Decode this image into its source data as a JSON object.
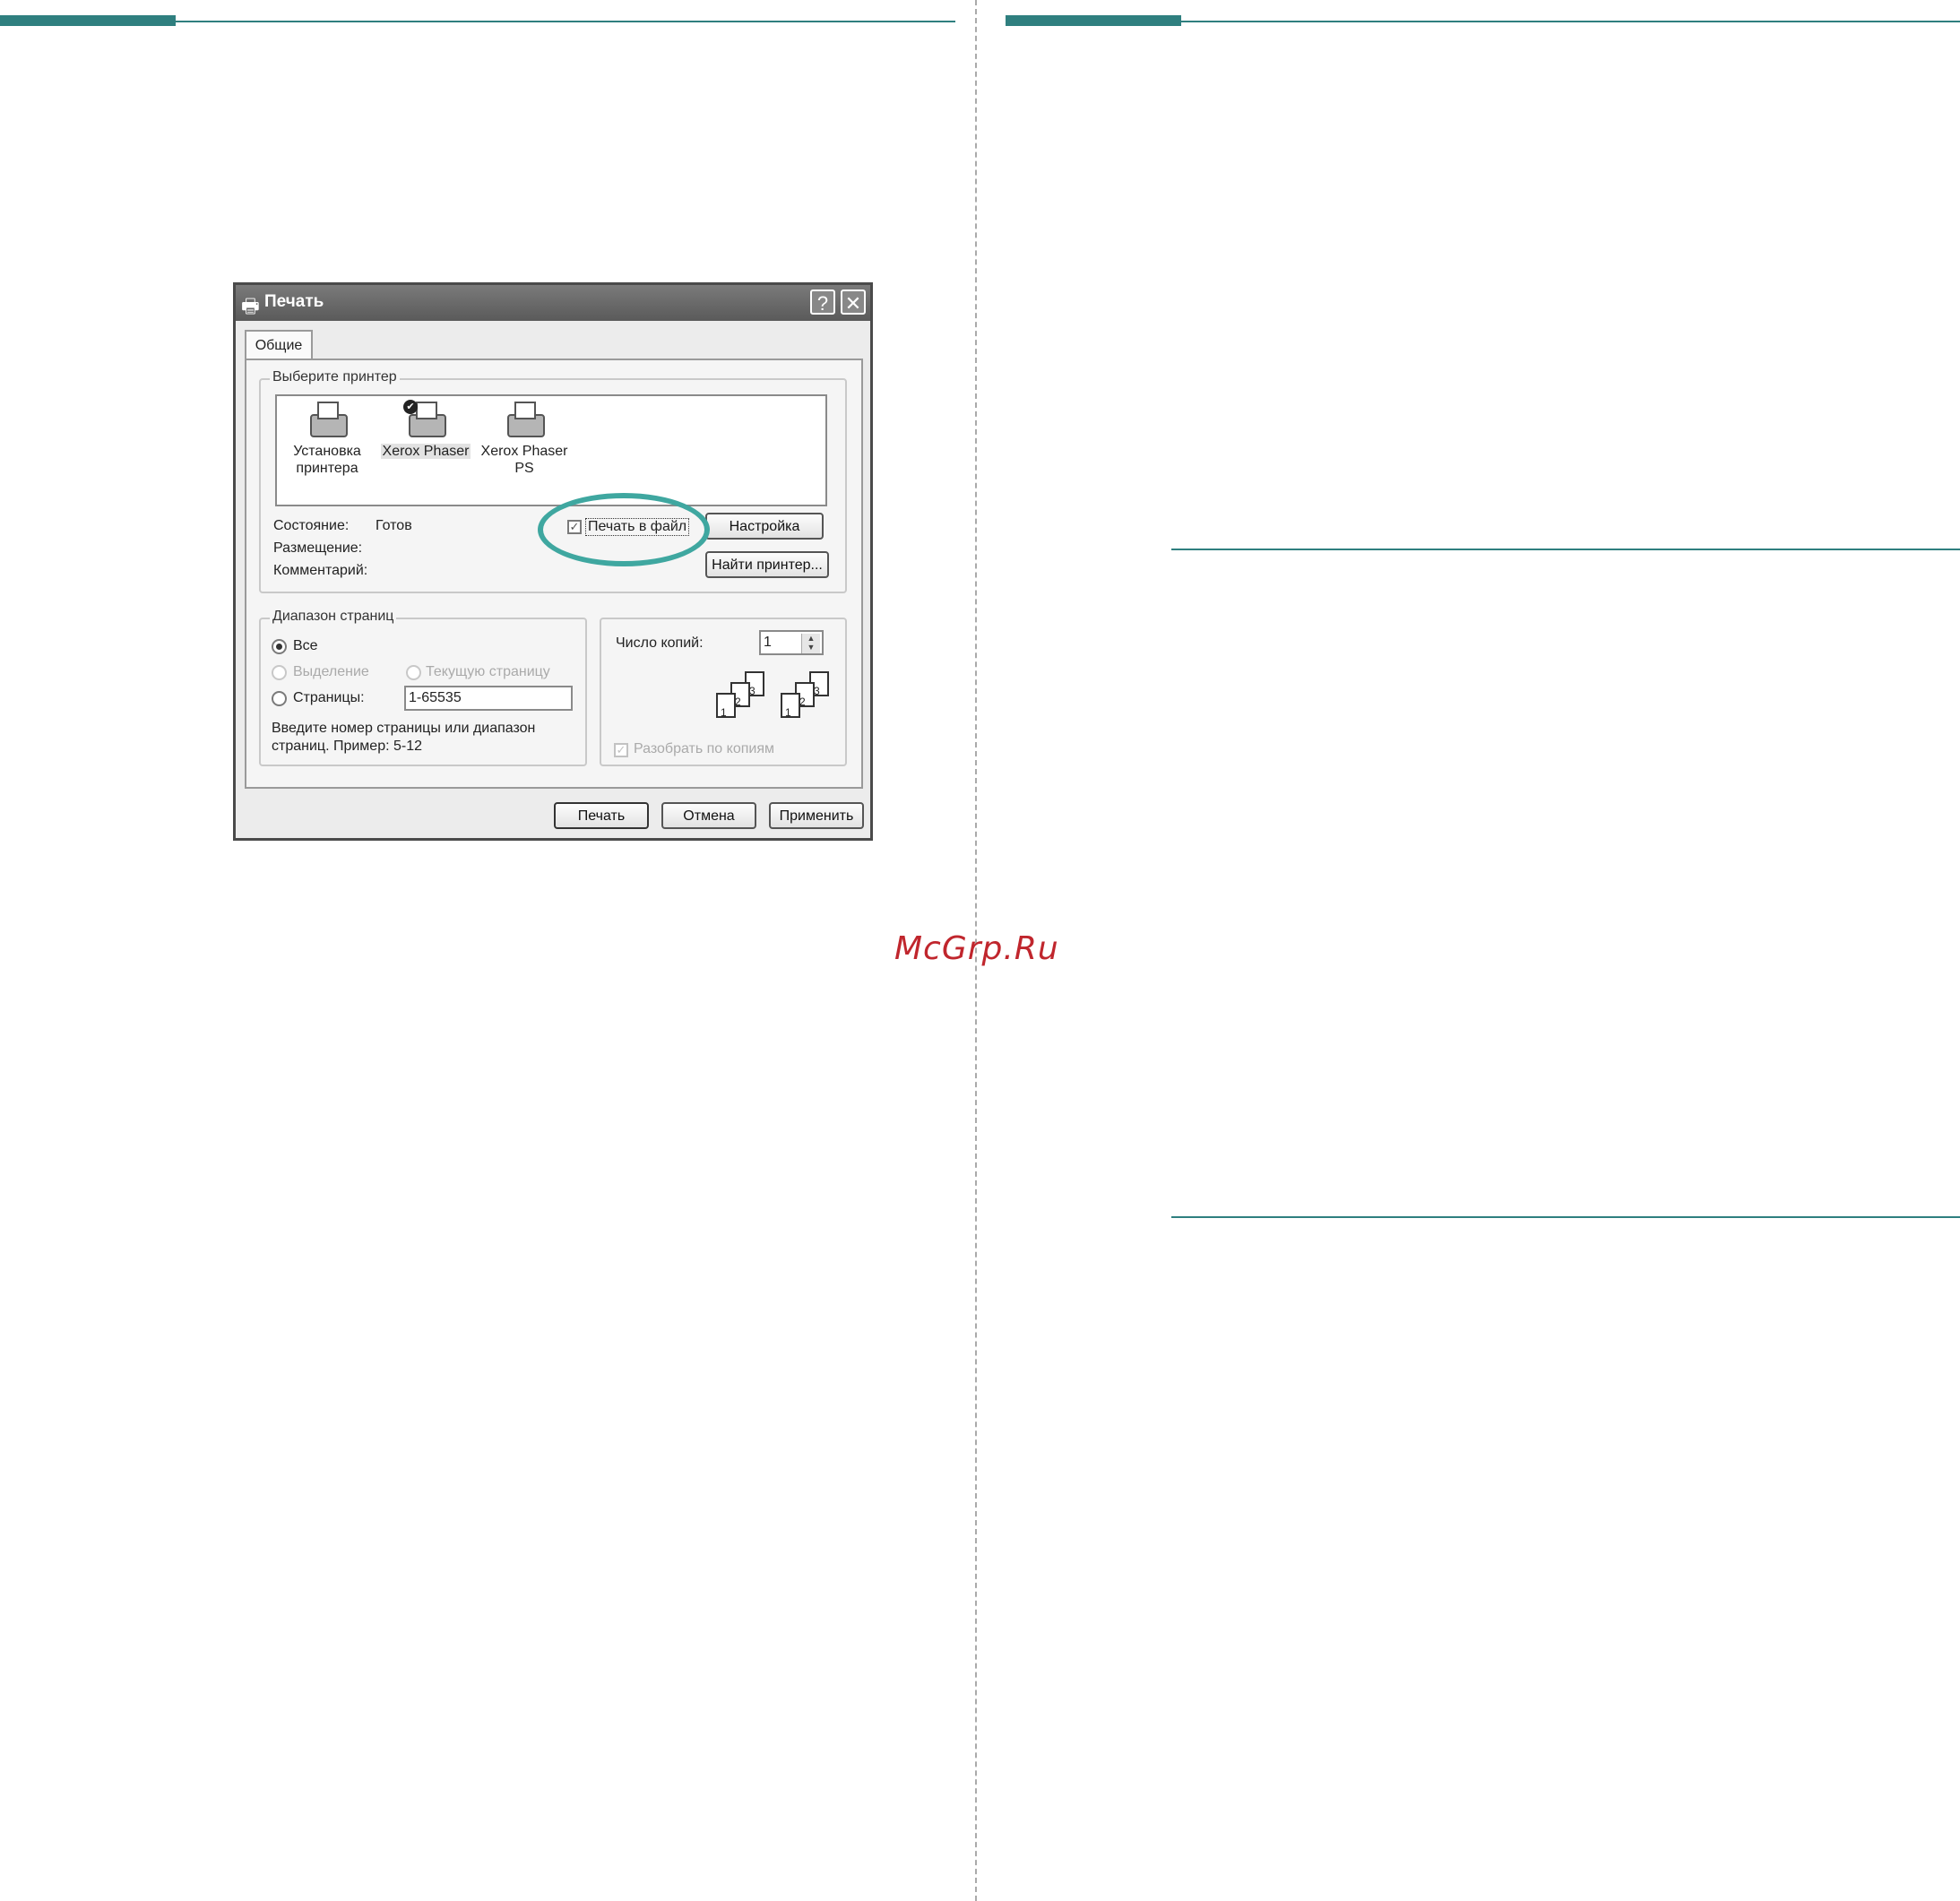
{
  "watermark": "McGrp.Ru",
  "dialog": {
    "title": "Печать",
    "help_btn": "?",
    "close_btn": "✕",
    "tab": "Общие",
    "printer_group": {
      "label": "Выберите принтер",
      "printers": [
        {
          "name_line1": "Установка",
          "name_line2": "принтера",
          "icon": "add-printer-icon"
        },
        {
          "name_line1": "Xerox Phaser",
          "name_line2": "",
          "icon": "printer-icon",
          "selected": true,
          "default": true
        },
        {
          "name_line1": "Xerox Phaser",
          "name_line2": "PS",
          "icon": "printer-icon"
        }
      ],
      "status_label": "Состояние:",
      "status_value": "Готов",
      "location_label": "Размещение:",
      "comment_label": "Комментарий:",
      "print_to_file": "Печать в файл",
      "print_to_file_checked": true,
      "settings_button": "Настройка",
      "find_button": "Найти принтер..."
    },
    "range_group": {
      "label": "Диапазон страниц",
      "all": "Все",
      "selection": "Выделение",
      "current_page": "Текущую страницу",
      "pages": "Страницы:",
      "pages_value": "1-65535",
      "hint_line1": "Введите номер страницы или диапазон",
      "hint_line2": "страниц.  Пример: 5-12",
      "selected_option": "Все"
    },
    "copies_group": {
      "label": "Число копий:",
      "value": "1",
      "collate": "Разобрать по копиям",
      "collate_checked": true,
      "collate_pages": [
        "1",
        "2",
        "3"
      ]
    },
    "buttons": {
      "print": "Печать",
      "cancel": "Отмена",
      "apply": "Применить"
    }
  },
  "colors": {
    "accent": "#2f7f7f",
    "highlight_oval": "#3fa7a0",
    "watermark": "#c0262d"
  }
}
